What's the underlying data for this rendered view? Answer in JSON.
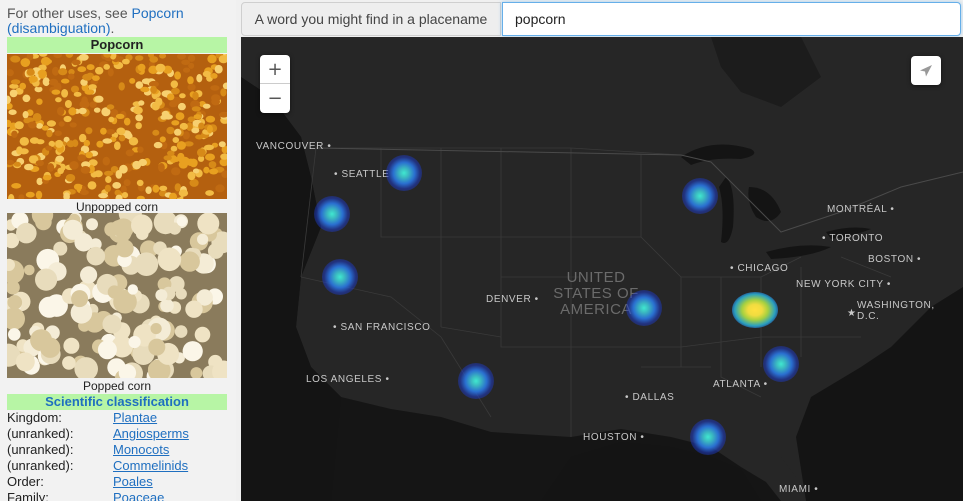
{
  "sidebar": {
    "hatnote_prefix": "For other uses, see ",
    "hatnote_link": "Popcorn (disambiguation)",
    "hatnote_suffix": ".",
    "infobox_title": "Popcorn",
    "caption_kernels": "Unpopped corn",
    "caption_popped": "Popped corn",
    "classification_header": "Scientific classification",
    "taxonomy": [
      {
        "label": "Kingdom:",
        "value": "Plantae"
      },
      {
        "label": "(unranked):",
        "value": "Angiosperms"
      },
      {
        "label": "(unranked):",
        "value": "Monocots"
      },
      {
        "label": "(unranked):",
        "value": "Commelinids"
      },
      {
        "label": "Order:",
        "value": "Poales"
      },
      {
        "label": "Family:",
        "value": "Poaceae"
      }
    ]
  },
  "search": {
    "label": "A word you might find in a placename",
    "value": "popcorn"
  },
  "map": {
    "zoom_in_label": "+",
    "zoom_out_label": "−",
    "country_label": "UNITED STATES OF AMERICA",
    "cities": {
      "vancouver": "VANCOUVER",
      "seattle": "SEATTLE",
      "san_francisco": "SAN FRANCISCO",
      "los_angeles": "LOS ANGELES",
      "denver": "DENVER",
      "dallas": "DALLAS",
      "houston": "HOUSTON",
      "chicago": "CHICAGO",
      "atlanta": "ATLANTA",
      "miami": "MIAMI",
      "montreal": "MONTRÉAL",
      "toronto": "TORONTO",
      "boston": "BOSTON",
      "new_york": "NEW YORK CITY",
      "washington": "WASHINGTON, D.C."
    },
    "colors": {
      "background": "#151515",
      "land": "#262626",
      "water": "#141414",
      "heat_low": "#2a6fd0",
      "heat_mid": "#40e8d0",
      "heat_high": "#ffe040"
    }
  }
}
